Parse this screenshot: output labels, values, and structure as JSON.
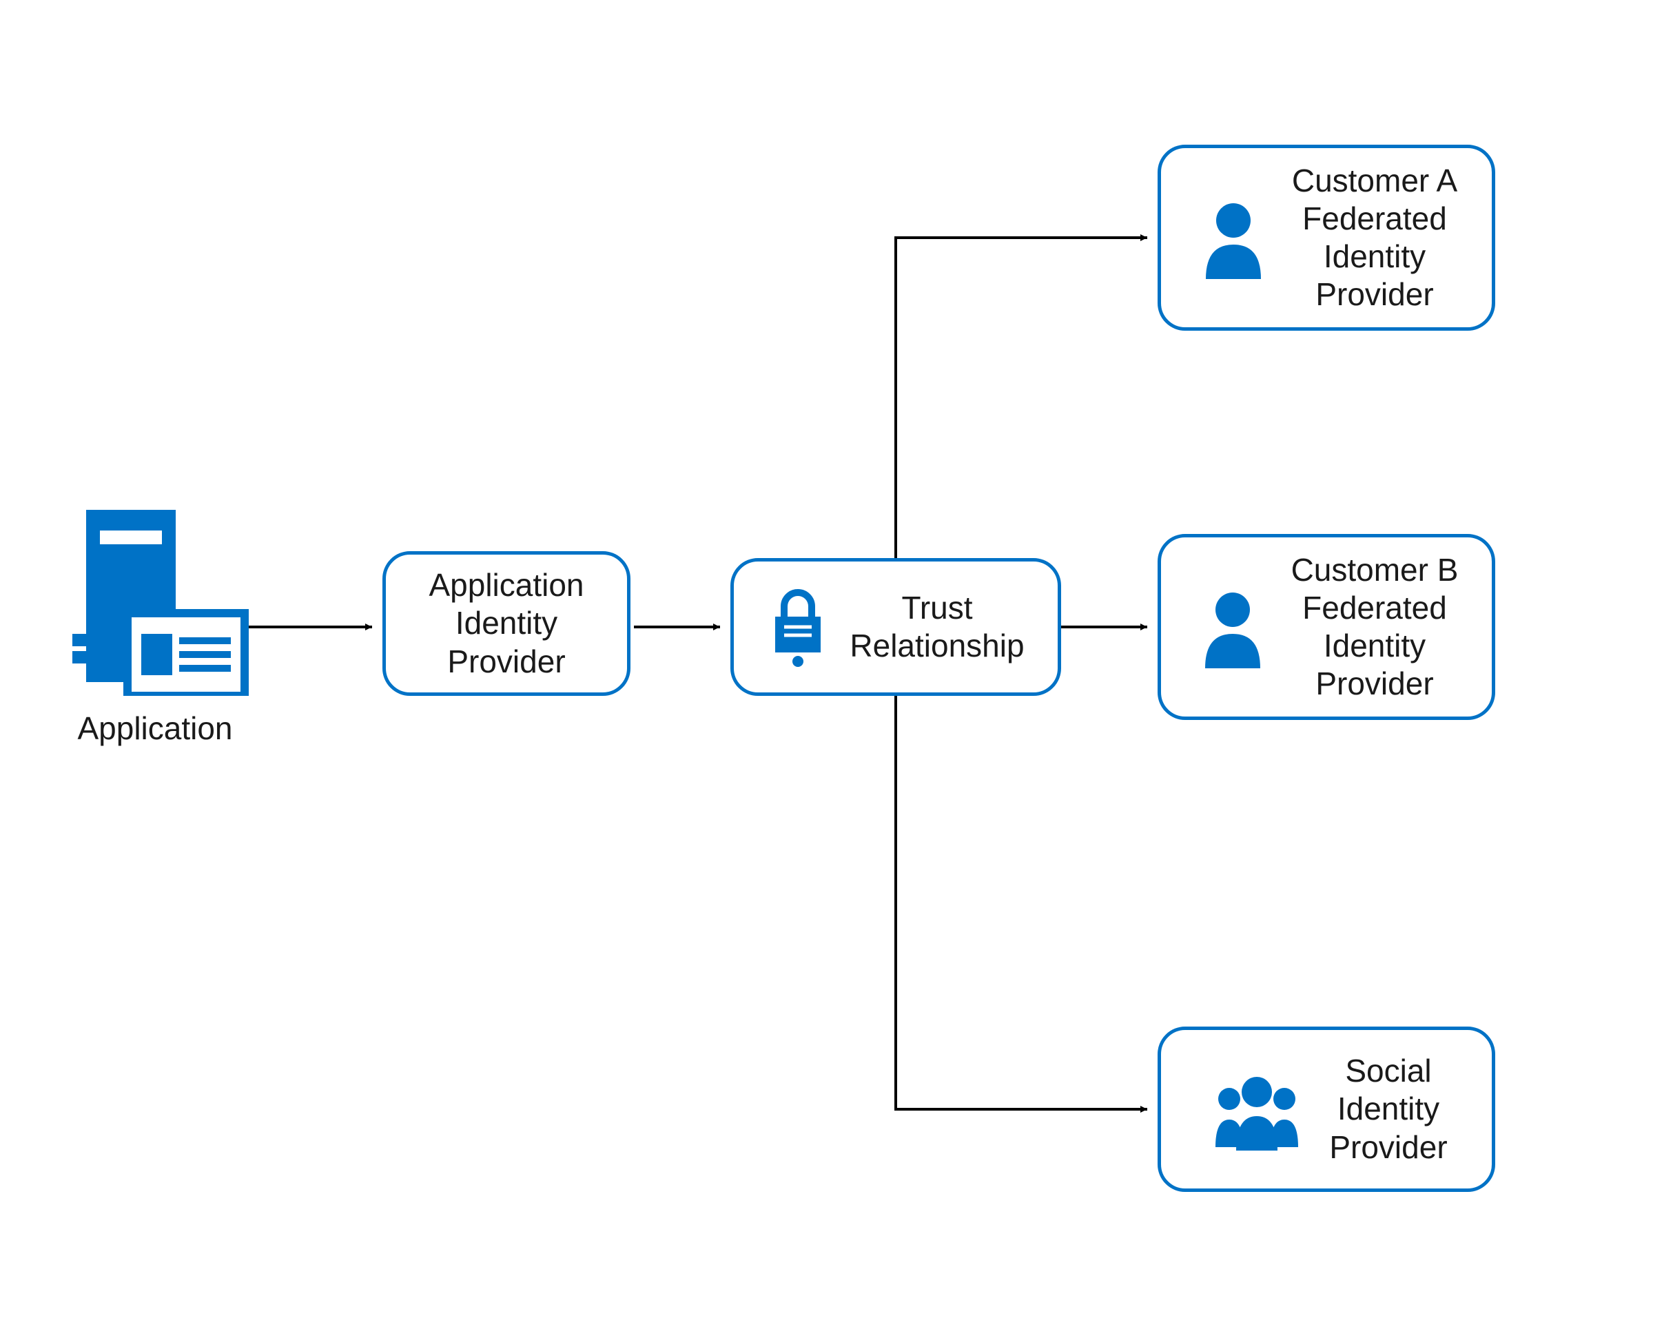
{
  "colors": {
    "brand": "#0072c6",
    "line": "#000000",
    "text": "#1a1a1a"
  },
  "nodes": {
    "application": {
      "label": "Application"
    },
    "app_idp": {
      "label_l1": "Application",
      "label_l2": "Identity",
      "label_l3": "Provider"
    },
    "trust": {
      "label_l1": "Trust",
      "label_l2": "Relationship"
    },
    "customer_a": {
      "label_l1": "Customer A",
      "label_l2": "Federated",
      "label_l3": "Identity",
      "label_l4": "Provider"
    },
    "customer_b": {
      "label_l1": "Customer B",
      "label_l2": "Federated",
      "label_l3": "Identity",
      "label_l4": "Provider"
    },
    "social": {
      "label_l1": "Social",
      "label_l2": "Identity",
      "label_l3": "Provider"
    }
  },
  "icons": {
    "application": "server-with-browser",
    "trust": "padlock",
    "customer_a": "person",
    "customer_b": "person",
    "social": "people-group"
  }
}
